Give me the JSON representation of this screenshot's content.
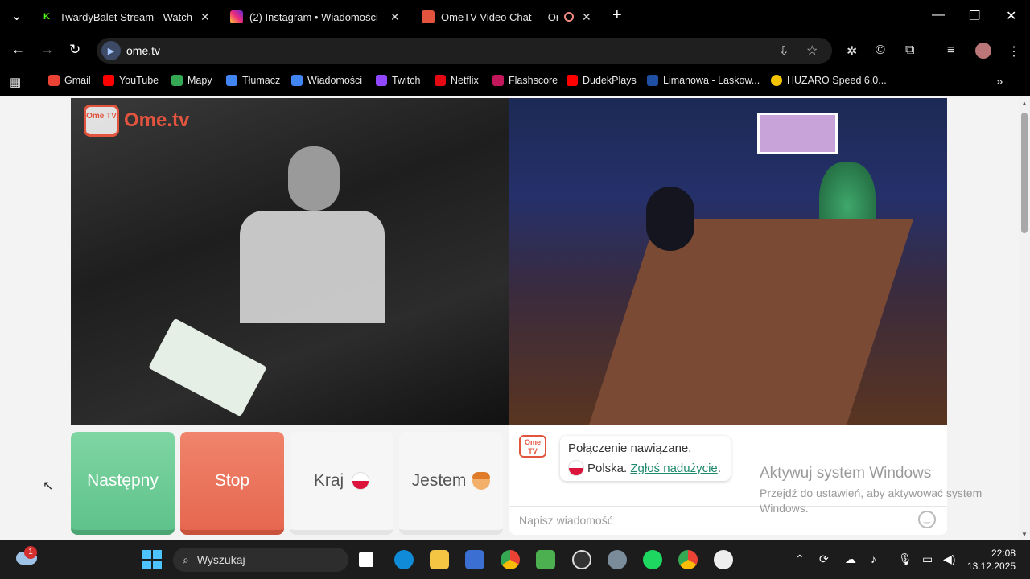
{
  "browser": {
    "tabs": [
      {
        "title": "TwardyBalet Stream - Watch Liv",
        "active": false
      },
      {
        "title": "(2) Instagram • Wiadomości",
        "active": false
      },
      {
        "title": "OmeTV Video Chat — Ome",
        "active": true
      }
    ],
    "new_tab": "+",
    "url": "ome.tv",
    "bookmarks": [
      {
        "label": "Gmail",
        "color": "#ea4335"
      },
      {
        "label": "YouTube",
        "color": "#ff0000"
      },
      {
        "label": "Mapy",
        "color": "#34a853"
      },
      {
        "label": "Tłumacz",
        "color": "#4285f4"
      },
      {
        "label": "Wiadomości",
        "color": "#4285f4"
      },
      {
        "label": "Twitch",
        "color": "#9146ff"
      },
      {
        "label": "Netflix",
        "color": "#e50914"
      },
      {
        "label": "Flashscore",
        "color": "#c2185b"
      },
      {
        "label": "DudekPlays",
        "color": "#ff0000"
      },
      {
        "label": "Limanowa - Laskow...",
        "color": "#1e4fa3"
      },
      {
        "label": "HUZARO Speed 6.0...",
        "color": "#f5c400"
      }
    ]
  },
  "page": {
    "logo_text": "Ome.tv",
    "logo_badge": "Ome TV",
    "buttons": {
      "next": "Następny",
      "stop": "Stop",
      "country": "Kraj",
      "gender": "Jestem"
    },
    "chat": {
      "status": "Połączenie nawiązane.",
      "country": "Polska.",
      "report_link": "Zgłoś nadużycie",
      "report_suffix": ".",
      "placeholder": "Napisz wiadomość"
    },
    "watermark": {
      "title": "Aktywuj system Windows",
      "subtitle": "Przejdź do ustawień, aby aktywować system Windows."
    }
  },
  "taskbar": {
    "search_placeholder": "Wyszukaj",
    "weather_badge": "1",
    "time": "22:08",
    "date": "13.12.2025"
  }
}
